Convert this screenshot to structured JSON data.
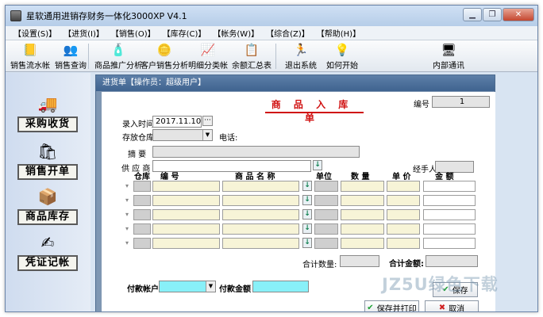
{
  "window": {
    "title": "星软通用进销存财务一体化3000XP V4.1",
    "buttons": {
      "minimize": "▁",
      "restore": "❐",
      "close": "✕"
    }
  },
  "menu": [
    "【设置(S)】",
    "【进货(I)】",
    "【销售(O)】",
    "【库存(C)】",
    "【帐务(W)】",
    "【综合(Z)】",
    "【帮助(H)】"
  ],
  "toolbar": {
    "items": [
      {
        "label": "销售流水帐",
        "icon": "ledger-icon"
      },
      {
        "label": "销售查询",
        "icon": "people-search-icon"
      },
      {
        "label": "商品推广分析",
        "icon": "bottle-icon"
      },
      {
        "label": "客户销售分析",
        "icon": "coins-icon"
      },
      {
        "label": "明细分类帐",
        "icon": "chart-icon"
      },
      {
        "label": "余额汇总表",
        "icon": "report-icon"
      },
      {
        "label": "退出系统",
        "icon": "runner-icon"
      },
      {
        "label": "如何开始",
        "icon": "lightbulb-icon"
      },
      {
        "label": "内部通讯",
        "icon": "computer-icon"
      }
    ]
  },
  "left_panel": [
    {
      "label": "采购收货",
      "icon": "truck-icon"
    },
    {
      "label": "销售开单",
      "icon": "sales-icon"
    },
    {
      "label": "商品库存",
      "icon": "box-icon"
    },
    {
      "label": "凭证记帐",
      "icon": "pen-icon"
    }
  ],
  "child_window": {
    "title": "进货单【操作员：超级用户】"
  },
  "form": {
    "heading": "商 品 入 库 单",
    "number_label": "编号",
    "number_value": "1",
    "entry_time_label": "录入时间",
    "entry_time_value": "2017.11.10",
    "entry_time_btn": "···",
    "warehouse_label": "存放仓库",
    "warehouse_value": "",
    "phone_label": "电话:",
    "summary_label": "摘   要",
    "summary_value": "",
    "supplier_label": "供 应 商",
    "supplier_value": "",
    "supplier_pick": "↓",
    "handler_label": "经手人",
    "handler_value": "",
    "columns": [
      "仓库",
      "编   号",
      "商 品 名 称",
      "单位",
      "数  量",
      "单  价",
      "金    额"
    ],
    "rows": [
      {
        "warehouse": "",
        "code": "",
        "name": "",
        "unit": "",
        "qty": "",
        "price": "",
        "amount": ""
      },
      {
        "warehouse": "",
        "code": "",
        "name": "",
        "unit": "",
        "qty": "",
        "price": "",
        "amount": ""
      },
      {
        "warehouse": "",
        "code": "",
        "name": "",
        "unit": "",
        "qty": "",
        "price": "",
        "amount": ""
      },
      {
        "warehouse": "",
        "code": "",
        "name": "",
        "unit": "",
        "qty": "",
        "price": "",
        "amount": ""
      },
      {
        "warehouse": "",
        "code": "",
        "name": "",
        "unit": "",
        "qty": "",
        "price": "",
        "amount": ""
      }
    ],
    "row_marker": "▾",
    "row_pick": "↓",
    "total_qty_label": "合计数量:",
    "total_amount_label": "合计金额:",
    "pay_account_label": "付款帐户",
    "pay_account_value": "",
    "pay_amount_label": "付款金额",
    "pay_amount_value": "",
    "save_label": "保存",
    "save_print_label": "保存并打印",
    "cancel_label": "取消"
  },
  "watermark": "JZ5U绿色下载"
}
